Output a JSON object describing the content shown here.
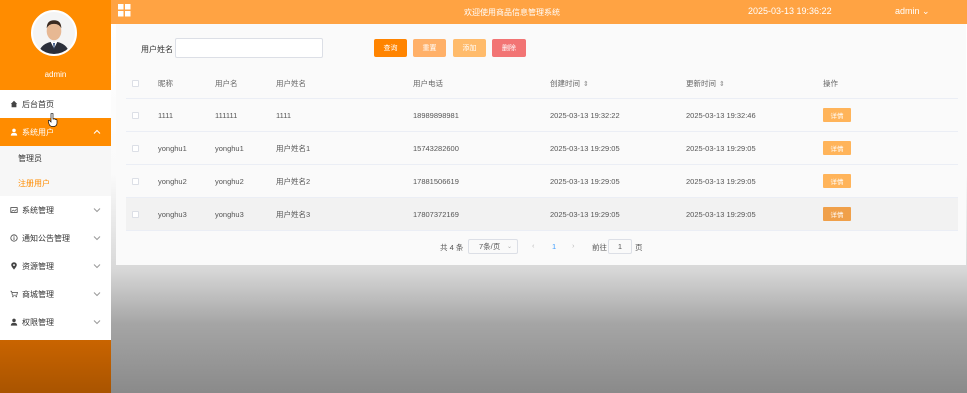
{
  "sidebar": {
    "admin_name": "admin",
    "menu": [
      {
        "label": "后台首页",
        "icon": "home-icon"
      },
      {
        "label": "系统用户",
        "icon": "user-icon"
      },
      {
        "label": "系统管理",
        "icon": "image-icon"
      },
      {
        "label": "通知公告管理",
        "icon": "info-icon"
      },
      {
        "label": "资源管理",
        "icon": "location-icon"
      },
      {
        "label": "商城管理",
        "icon": "cart-icon"
      },
      {
        "label": "权限管理",
        "icon": "user-icon"
      }
    ],
    "sub_items": [
      "管理员",
      "注册用户"
    ]
  },
  "header": {
    "title": "欢迎使用商品信息管理系统",
    "datetime": "2025-03-13 19:36:22",
    "user": "admin"
  },
  "search": {
    "label": "用户姓名",
    "value": "",
    "buttons": {
      "query": "查询",
      "reset": "重置",
      "add": "添加",
      "delete": "删除"
    }
  },
  "table": {
    "headers": [
      "昵称",
      "用户名",
      "用户姓名",
      "用户电话",
      "创建时间",
      "更新时间",
      "操作"
    ],
    "rows": [
      {
        "nickname": "1111",
        "username": "111111",
        "fullname": "1111",
        "phone": "18989898981",
        "created": "2025-03-13 19:32:22",
        "updated": "2025-03-13 19:32:46",
        "action": "详情"
      },
      {
        "nickname": "yonghu1",
        "username": "yonghu1",
        "fullname": "用户姓名1",
        "phone": "15743282600",
        "created": "2025-03-13 19:29:05",
        "updated": "2025-03-13 19:29:05",
        "action": "详情"
      },
      {
        "nickname": "yonghu2",
        "username": "yonghu2",
        "fullname": "用户姓名2",
        "phone": "17881506619",
        "created": "2025-03-13 19:29:05",
        "updated": "2025-03-13 19:29:05",
        "action": "详情"
      },
      {
        "nickname": "yonghu3",
        "username": "yonghu3",
        "fullname": "用户姓名3",
        "phone": "17807372169",
        "created": "2025-03-13 19:29:05",
        "updated": "2025-03-13 19:29:05",
        "action": "详情"
      }
    ]
  },
  "pagination": {
    "total": "共 4 条",
    "page_size": "7条/页",
    "current_page": "1",
    "goto_label": "前往",
    "goto_value": "1",
    "page_unit": "页"
  },
  "colors": {
    "accent": "#ff8c00",
    "topbar": "#ffa343",
    "delete": "#f27474"
  }
}
